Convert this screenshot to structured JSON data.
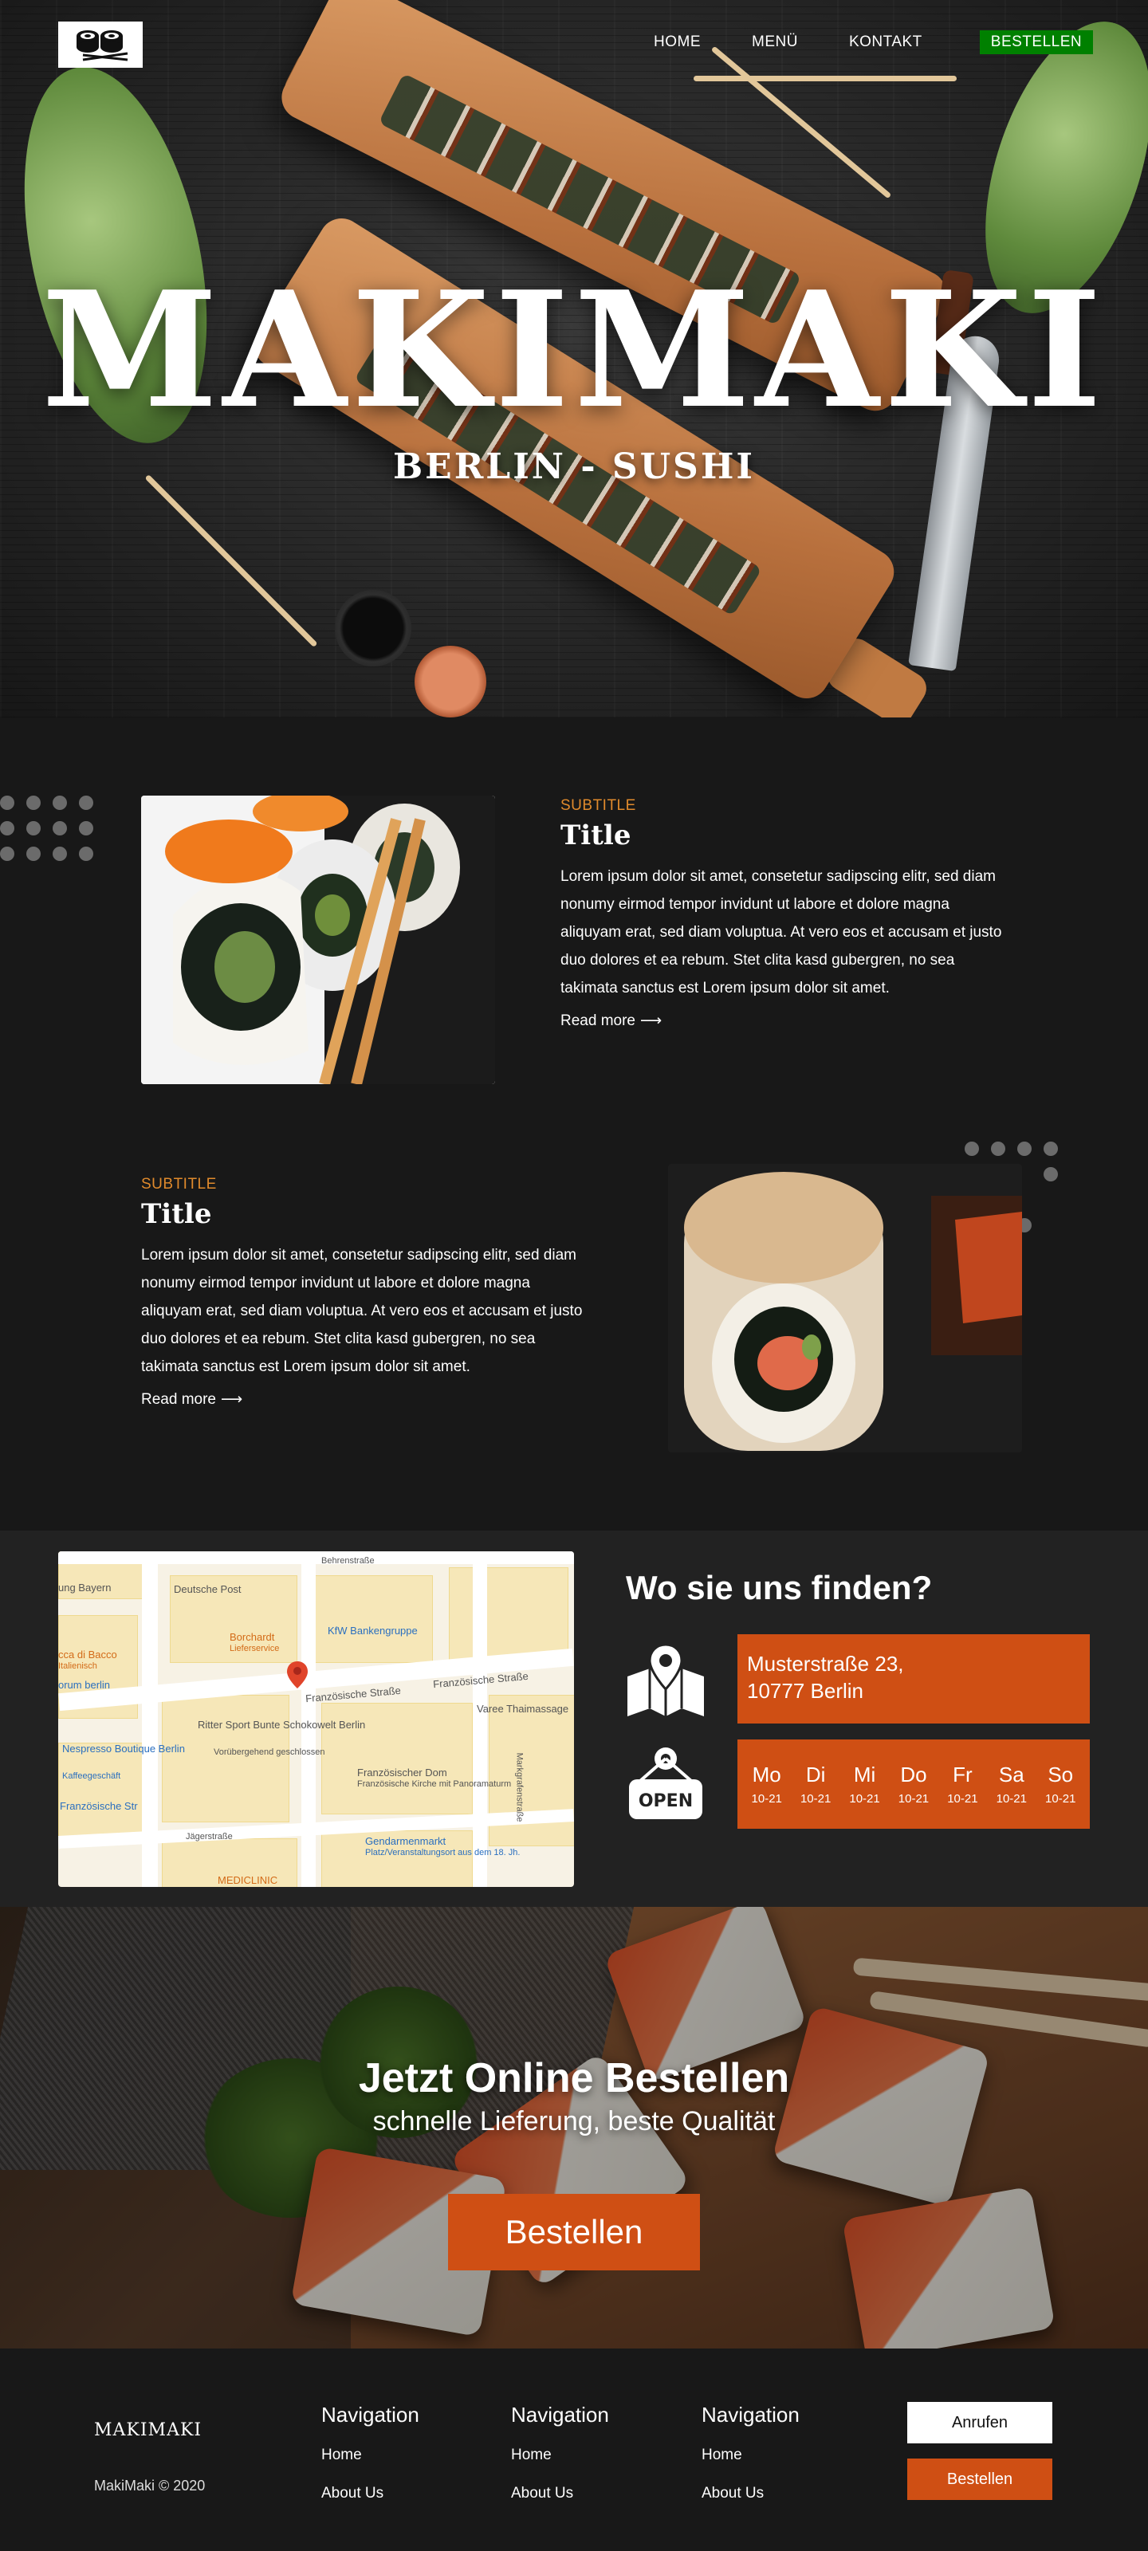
{
  "header": {
    "nav": [
      "HOME",
      "MENÜ",
      "KONTAKT"
    ],
    "cta": "BESTELLEN"
  },
  "hero": {
    "title": "MAKIMAKI",
    "subtitle": "BERLIN - SUSHI"
  },
  "features": [
    {
      "subtitle": "SUBTITLE",
      "title": "Title",
      "body": "Lorem ipsum dolor sit amet, consetetur sadipscing elitr, sed diam nonumy eirmod tempor invidunt ut labore et dolore magna aliquyam erat, sed diam voluptua. At vero eos et accusam et justo duo dolores et ea rebum. Stet clita kasd gubergren, no sea takimata sanctus est Lorem ipsum dolor sit amet.",
      "link": "Read more"
    },
    {
      "subtitle": "SUBTITLE",
      "title": "Title",
      "body": "Lorem ipsum dolor sit amet, consetetur sadipscing elitr, sed diam nonumy eirmod tempor invidunt ut labore et dolore magna aliquyam erat, sed diam voluptua. At vero eos et accusam et justo duo dolores et ea rebum. Stet clita kasd gubergren, no sea takimata sanctus est Lorem ipsum dolor sit amet.",
      "link": "Read more"
    }
  ],
  "map": {
    "labels": [
      "Deutsche Post",
      "Borchardt",
      "Lieferservice",
      "KfW Bankengruppe",
      "Französische Straße",
      "Französische Straße",
      "Ritter Sport Bunte Schokowelt Berlin",
      "Vorübergehend geschlossen",
      "Nespresso Boutique Berlin",
      "Kaffeegeschäft",
      "Französischer Dom",
      "Französische Kirche mit Panoramaturm",
      "Gendarmenmarkt",
      "Platz/Veranstaltungsort aus dem 18. Jh.",
      "Varee Thaimassage",
      "Behrenstraße",
      "Jägerstraße",
      "Markgrafenstraße",
      "MEDICLINIC",
      "Französische Str",
      "ccа di Bacco",
      "Italienisch",
      "ung Bayern",
      "orum berlin"
    ]
  },
  "location": {
    "title": "Wo sie uns finden?",
    "address_line1": "Musterstraße 23,",
    "address_line2": "10777 Berlin",
    "open_badge": "OPEN",
    "hours": [
      {
        "day": "Mo",
        "time": "10-21"
      },
      {
        "day": "Di",
        "time": "10-21"
      },
      {
        "day": "Mi",
        "time": "10-21"
      },
      {
        "day": "Do",
        "time": "10-21"
      },
      {
        "day": "Fr",
        "time": "10-21"
      },
      {
        "day": "Sa",
        "time": "10-21"
      },
      {
        "day": "So",
        "time": "10-21"
      }
    ]
  },
  "order": {
    "title": "Jetzt Online Bestellen",
    "subtitle": "schnelle Lieferung, beste Qualität",
    "button": "Bestellen"
  },
  "footer": {
    "brand": "MAKIMAKI",
    "copyright": "MakiMaki © 2020",
    "columns": [
      {
        "heading": "Navigation",
        "links": [
          "Home",
          "About Us"
        ]
      },
      {
        "heading": "Navigation",
        "links": [
          "Home",
          "About Us"
        ]
      },
      {
        "heading": "Navigation",
        "links": [
          "Home",
          "About Us"
        ]
      }
    ],
    "call_button": "Anrufen",
    "order_button": "Bestellen"
  },
  "colors": {
    "accent": "#cf4f14",
    "nav_cta": "#008000",
    "subtitle": "#e08a2c",
    "background": "#181818"
  },
  "icons": [
    "sushi-logo-icon",
    "map-pin-icon",
    "open-sign-icon",
    "arrow-right-icon"
  ]
}
